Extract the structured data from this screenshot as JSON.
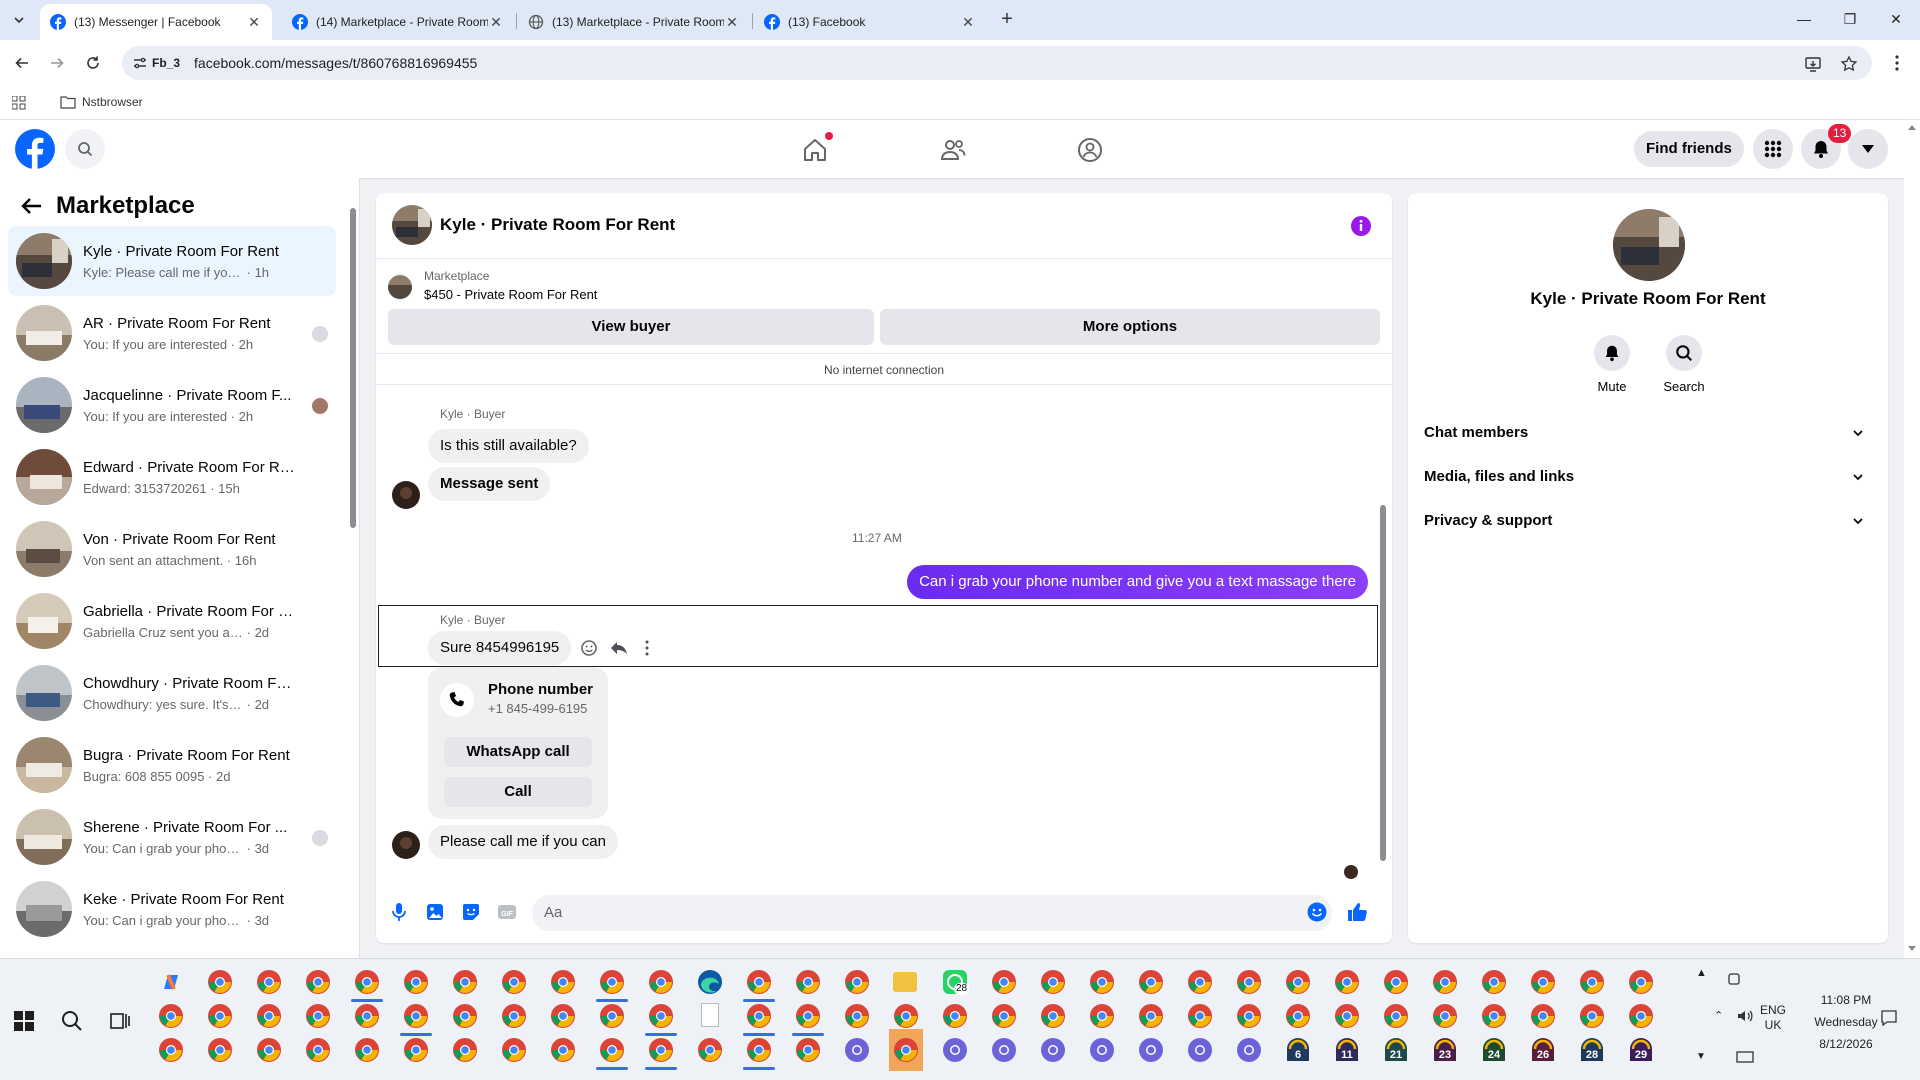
{
  "browser": {
    "tabs": [
      {
        "title": "(13) Messenger | Facebook",
        "active": true
      },
      {
        "title": "(14) Marketplace - Private Room",
        "active": false
      },
      {
        "title": "(13) Marketplace - Private Room",
        "active": false
      },
      {
        "title": "(13) Facebook",
        "active": false
      }
    ],
    "site_chip": "Fb_3",
    "url": "facebook.com/messages/t/860768816969455",
    "bookmark": "Nstbrowser"
  },
  "header": {
    "find_friends": "Find friends",
    "notification_count": "13"
  },
  "left_panel": {
    "title": "Marketplace",
    "chats": [
      {
        "name": "Kyle · Private Room For Rent",
        "preview": "Kyle: Please call me if you can",
        "time": "1h",
        "active": true
      },
      {
        "name": "AR · Private Room For Rent",
        "preview": "You: If you are interested",
        "time": "2h"
      },
      {
        "name": "Jacquelinne · Private Room F...",
        "preview": "You: If you are interested",
        "time": "2h"
      },
      {
        "name": "Edward · Private Room For Rent",
        "preview": "Edward: 3153720261",
        "time": "15h"
      },
      {
        "name": "Von · Private Room For Rent",
        "preview": "Von sent an attachment.",
        "time": "16h"
      },
      {
        "name": "Gabriella · Private Room For Rent",
        "preview": "Gabriella Cruz sent you a messag...",
        "time": "2d"
      },
      {
        "name": "Chowdhury · Private Room For ...",
        "preview": "Chowdhury: yes sure. It's 347599...",
        "time": "2d"
      },
      {
        "name": "Bugra · Private Room For Rent",
        "preview": "Bugra: 608 855 0095",
        "time": "2d"
      },
      {
        "name": "Sherene · Private Room For ...",
        "preview": "You: Can i grab your phone nu...",
        "time": "3d"
      },
      {
        "name": "Keke · Private Room For Rent",
        "preview": "You: Can i grab your phone numb...",
        "time": "3d"
      }
    ]
  },
  "conversation": {
    "title": "Kyle · Private Room For Rent",
    "marketplace_label": "Marketplace",
    "listing": "$450 - Private Room For Rent",
    "view_buyer": "View buyer",
    "more_options": "More options",
    "connection_status": "No internet connection",
    "sender_label": "Kyle · Buyer",
    "messages": {
      "m1": "Is this still available?",
      "m2": "Message sent",
      "timestamp": "11:27 AM",
      "mine": "Can i grab your phone number and give  you a text massage there",
      "m3": "Sure 8454996195",
      "m4": "Please call me if you can"
    },
    "phone_card": {
      "title": "Phone number",
      "number": "+1 845-499-6195",
      "whatsapp": "WhatsApp call",
      "call": "Call"
    },
    "composer_placeholder": "Aa"
  },
  "right_panel": {
    "name": "Kyle · Private Room For Rent",
    "mute": "Mute",
    "search": "Search",
    "sections": [
      "Chat members",
      "Media, files and links",
      "Privacy & support"
    ]
  },
  "taskbar": {
    "whatsapp_badge": "28",
    "numbered_badges": [
      "6",
      "11",
      "21",
      "23",
      "24",
      "26",
      "28",
      "29"
    ],
    "language": "ENG",
    "region": "UK",
    "time": "11:08 PM",
    "day": "Wednesday",
    "date": "8/12/2026"
  },
  "colors": {
    "facebook_blue": "#0866ff",
    "messenger_purple": "#7b2ff7",
    "badge_red": "#e41e3f"
  }
}
